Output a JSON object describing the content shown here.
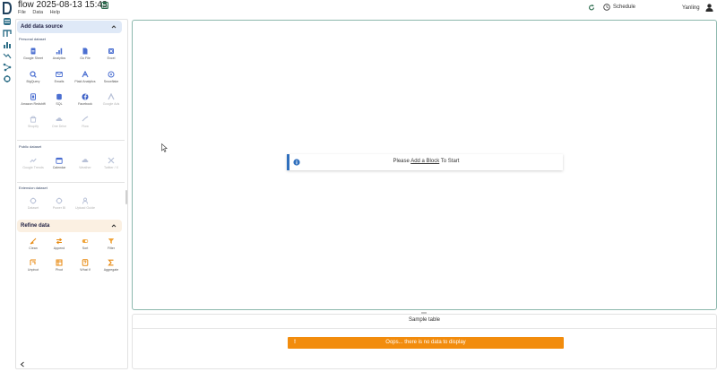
{
  "app": {
    "title": "flow 2025-08-13 15:43",
    "menu": [
      "File",
      "Data",
      "Help"
    ],
    "schedule_label": "Schedule",
    "user_name": "Yanling"
  },
  "colors": {
    "accent_teal": "#8cb8ad",
    "info_blue": "#2f6fbd",
    "warning_orange": "#f28c0d",
    "section_blue": "#dfe9f7",
    "section_orange": "#fbf0e2"
  },
  "panel": {
    "add_data_source": {
      "label": "Add data source",
      "groups": {
        "personal": {
          "label": "Personal dataset",
          "items": [
            {
              "label": "Google Sheet",
              "icon": "google-sheet-icon"
            },
            {
              "label": "Analytics",
              "icon": "analytics-icon"
            },
            {
              "label": "Go File",
              "icon": "file-icon"
            },
            {
              "label": "Excel",
              "icon": "excel-icon"
            },
            {
              "label": "BigQuery",
              "icon": "bigquery-icon"
            },
            {
              "label": "Emails",
              "icon": "email-icon"
            },
            {
              "label": "Plaid Analytics",
              "icon": "plaid-icon"
            },
            {
              "label": "Snowflake",
              "icon": "snowflake-icon"
            },
            {
              "label": "Amazon Redshift",
              "icon": "redshift-icon"
            },
            {
              "label": "SQL",
              "icon": "sql-icon"
            },
            {
              "label": "Facebook",
              "icon": "facebook-icon"
            },
            {
              "label": "Google Ads",
              "icon": "google-ads-icon"
            },
            {
              "label": "Shopify",
              "icon": "shopify-icon"
            },
            {
              "label": "One Drive",
              "icon": "onedrive-icon"
            },
            {
              "label": "Flow",
              "icon": "flow-icon"
            }
          ]
        },
        "public": {
          "label": "Public dataset",
          "items": [
            {
              "label": "Google Trends",
              "icon": "trends-icon"
            },
            {
              "label": "Calendar",
              "icon": "calendar-icon"
            },
            {
              "label": "Weather",
              "icon": "weather-icon"
            },
            {
              "label": "Twitter / X",
              "icon": "x-icon"
            }
          ]
        },
        "extension": {
          "label": "Extension dataset",
          "items": [
            {
              "label": "Dataset",
              "icon": "dataset-icon"
            },
            {
              "label": "Power BI",
              "icon": "powerbi-icon"
            },
            {
              "label": "Upload Guide",
              "icon": "upload-icon"
            }
          ]
        }
      }
    },
    "refine_data": {
      "label": "Refine data",
      "items": [
        {
          "label": "Clean",
          "icon": "clean-icon"
        },
        {
          "label": "Append",
          "icon": "append-icon"
        },
        {
          "label": "Sort",
          "icon": "sort-icon"
        },
        {
          "label": "Filter",
          "icon": "filter-icon"
        },
        {
          "label": "Unpivot",
          "icon": "unpivot-icon"
        },
        {
          "label": "Pivot",
          "icon": "pivot-icon"
        },
        {
          "label": "What If",
          "icon": "what-if-icon"
        },
        {
          "label": "Aggregate",
          "icon": "aggregate-icon"
        }
      ]
    }
  },
  "canvas": {
    "notice_prefix": "Please",
    "notice_link": "Add a Block",
    "notice_suffix": "To Start"
  },
  "sample_table": {
    "title": "Sample table",
    "empty_message": "Oops... there is no data to display",
    "warning_glyph": "!"
  }
}
